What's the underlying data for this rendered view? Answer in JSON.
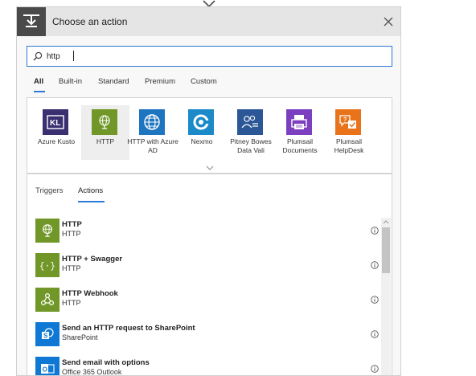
{
  "header": {
    "title": "Choose an action"
  },
  "search": {
    "value": "http"
  },
  "filter_tabs": [
    "All",
    "Built-in",
    "Standard",
    "Premium",
    "Custom"
  ],
  "connectors": [
    {
      "label": "Azure Kusto",
      "color": "#3a2f70",
      "icon": "kusto-icon"
    },
    {
      "label": "HTTP",
      "color": "#709727",
      "icon": "globe-icon"
    },
    {
      "label": "HTTP with Azure AD",
      "color": "#1e75c0",
      "icon": "globe-network-icon"
    },
    {
      "label": "Nexmo",
      "color": "#1c8ac9",
      "icon": "nexmo-icon"
    },
    {
      "label": "Pitney Bowes Data Vali",
      "color": "#2b5797",
      "icon": "people-check-icon"
    },
    {
      "label": "Plumsail Documents",
      "color": "#7b3fbf",
      "icon": "printer-icon"
    },
    {
      "label": "Plumsail HelpDesk",
      "color": "#e8731a",
      "icon": "helpdesk-icon"
    }
  ],
  "action_tabs": [
    "Triggers",
    "Actions"
  ],
  "actions": [
    {
      "title": "HTTP",
      "subtitle": "HTTP",
      "color": "#709727",
      "icon": "globe-icon"
    },
    {
      "title": "HTTP + Swagger",
      "subtitle": "HTTP",
      "color": "#709727",
      "icon": "swagger-icon"
    },
    {
      "title": "HTTP Webhook",
      "subtitle": "HTTP",
      "color": "#709727",
      "icon": "webhook-icon"
    },
    {
      "title": "Send an HTTP request to SharePoint",
      "subtitle": "SharePoint",
      "color": "#0f78d4",
      "icon": "sharepoint-icon"
    },
    {
      "title": "Send email with options",
      "subtitle": "Office 365 Outlook",
      "color": "#0f78d4",
      "icon": "outlook-icon"
    }
  ],
  "colors": {
    "accent": "#2a7ad6",
    "header_icon_bg": "#4a4a4a"
  }
}
